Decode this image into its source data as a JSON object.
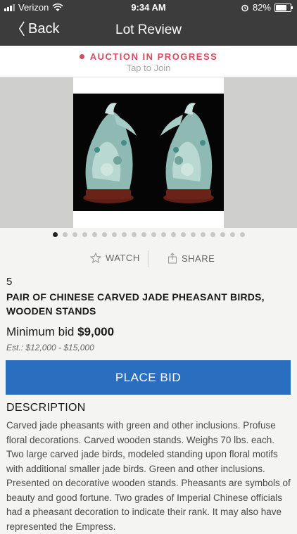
{
  "status_bar": {
    "carrier": "Verizon",
    "time": "9:34 AM",
    "battery_percent": "82%",
    "battery_level": 0.82
  },
  "nav": {
    "back_label": "Back",
    "title": "Lot Review"
  },
  "auction": {
    "status": "AUCTION IN PROGRESS",
    "join": "Tap to Join",
    "accent_color": "#d84a5d"
  },
  "gallery": {
    "image_count": 20,
    "active_index": 0
  },
  "actions": {
    "watch_label": "WATCH",
    "share_label": "SHARE"
  },
  "lot": {
    "number": "5",
    "title": "PAIR OF CHINESE CARVED JADE PHEASANT BIRDS, WOODEN STANDS",
    "min_bid_label": "Minimum bid",
    "min_bid_value": "$9,000",
    "estimate": "Est.: $12,000 - $15,000"
  },
  "bid_button": {
    "label": "PLACE BID",
    "color": "#2a6fbf"
  },
  "description": {
    "heading": "DESCRIPTION",
    "text": "Carved jade pheasants with green and other inclusions. Profuse floral decorations. Carved wooden stands. Weighs 70 lbs. each. Two large carved jade birds, modeled standing upon floral motifs with additional smaller jade birds. Green and other inclusions. Presented on decorative wooden stands. Pheasants are symbols of beauty and good fortune. Two grades of Imperial Chinese officials had a pheasant decoration to indicate their rank. It may also have represented the Empress."
  }
}
